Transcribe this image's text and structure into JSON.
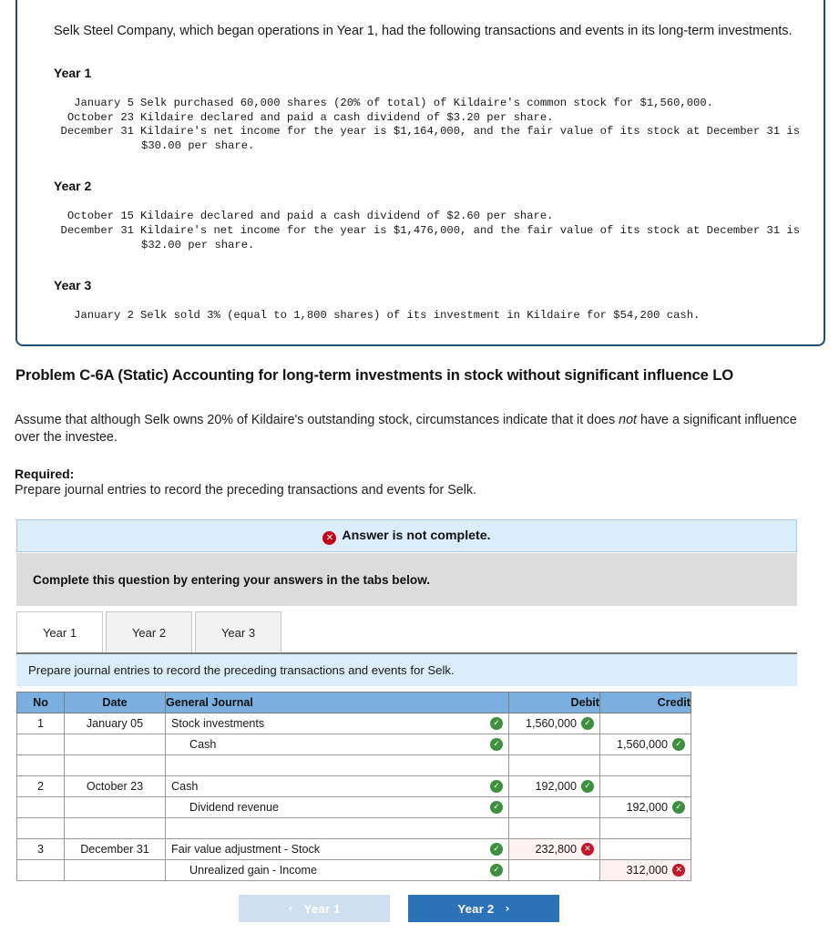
{
  "problem_box": {
    "intro": "Selk Steel Company, which began operations in Year 1, had the following transactions and events in its long-term investments.",
    "sections": [
      {
        "heading": "Year 1",
        "entries": [
          {
            "date": "January 5",
            "desc": "Selk purchased 60,000 shares (20% of total) of Kildaire's common stock for $1,560,000.",
            "cont": ""
          },
          {
            "date": "October 23",
            "desc": "Kildaire declared and paid a cash dividend of $3.20 per share.",
            "cont": ""
          },
          {
            "date": "December 31",
            "desc": "Kildaire's net income for the year is $1,164,000, and the fair value of its stock at December 31 is",
            "cont": "$30.00 per share."
          }
        ]
      },
      {
        "heading": "Year 2",
        "entries": [
          {
            "date": "October 15",
            "desc": "Kildaire declared and paid a cash dividend of $2.60 per share.",
            "cont": ""
          },
          {
            "date": "December 31",
            "desc": "Kildaire's net income for the year is $1,476,000, and the fair value of its stock at December 31 is",
            "cont": "$32.00 per share."
          }
        ]
      },
      {
        "heading": "Year 3",
        "entries": [
          {
            "date": "January 2",
            "desc": "Selk sold 3% (equal to 1,800 shares) of its investment in Kildaire for $54,200 cash.",
            "cont": ""
          }
        ]
      }
    ]
  },
  "problem_title": "Problem C-6A (Static) Accounting for long-term investments in stock without significant influence LO",
  "assumption_part1": "Assume that although Selk owns 20% of Kildaire's outstanding stock, circumstances indicate that it does ",
  "assumption_italic": "not",
  "assumption_part2": " have a significant influence over the investee.",
  "required_label": "Required:",
  "required_text": "Prepare journal entries to record the preceding transactions and events for Selk.",
  "alert": {
    "icon": "x-circle-icon",
    "icon_glyph": "✕",
    "text": "Answer is not complete."
  },
  "instruction_banner": "Complete this question by entering your answers in the tabs below.",
  "tabs": [
    {
      "label": "Year 1",
      "active": true
    },
    {
      "label": "Year 2",
      "active": false
    },
    {
      "label": "Year 3",
      "active": false
    }
  ],
  "sub_instruction": "Prepare journal entries to record the preceding transactions and events for Selk.",
  "table": {
    "headers": [
      "No",
      "Date",
      "General Journal",
      "Debit",
      "Credit"
    ],
    "rows": [
      {
        "no": "1",
        "date": "January 05",
        "account": "Stock investments",
        "indent": false,
        "account_status": "check",
        "debit": "1,560,000",
        "debit_status": "check",
        "credit": "",
        "credit_status": ""
      },
      {
        "no": "",
        "date": "",
        "account": "Cash",
        "indent": true,
        "account_status": "check",
        "debit": "",
        "debit_status": "",
        "credit": "1,560,000",
        "credit_status": "check"
      },
      {
        "no": "",
        "date": "",
        "account": "",
        "indent": false,
        "account_status": "",
        "debit": "",
        "debit_status": "",
        "credit": "",
        "credit_status": ""
      },
      {
        "no": "2",
        "date": "October 23",
        "account": "Cash",
        "indent": false,
        "account_status": "check",
        "debit": "192,000",
        "debit_status": "check",
        "credit": "",
        "credit_status": ""
      },
      {
        "no": "",
        "date": "",
        "account": "Dividend revenue",
        "indent": true,
        "account_status": "check",
        "debit": "",
        "debit_status": "",
        "credit": "192,000",
        "credit_status": "check"
      },
      {
        "no": "",
        "date": "",
        "account": "",
        "indent": false,
        "account_status": "",
        "debit": "",
        "debit_status": "",
        "credit": "",
        "credit_status": ""
      },
      {
        "no": "3",
        "date": "December 31",
        "account": "Fair value adjustment - Stock",
        "indent": false,
        "account_status": "check",
        "debit": "232,800",
        "debit_status": "cross",
        "credit": "",
        "credit_status": ""
      },
      {
        "no": "",
        "date": "",
        "account": "Unrealized gain - Income",
        "indent": true,
        "account_status": "check",
        "debit": "",
        "debit_status": "",
        "credit": "312,000",
        "credit_status": "cross"
      }
    ]
  },
  "nav": {
    "prev_label": "Year 1",
    "prev_chevron": "‹",
    "next_label": "Year 2",
    "next_chevron": "›"
  },
  "colors": {
    "box_border": "#1f4e79",
    "banner_blue": "#daedf9",
    "banner_gray": "#dcdcdc",
    "table_header": "#7aafe0",
    "check_green": "#3e8f3e",
    "cross_red": "#c0182a",
    "wrong_cell": "#fdf1f1",
    "btn_next": "#2c72b8",
    "btn_prev": "#cfdff0"
  }
}
